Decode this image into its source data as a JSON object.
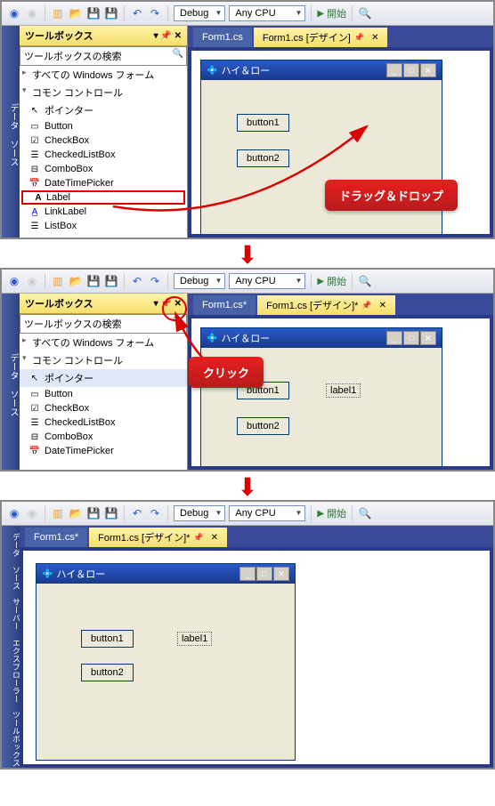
{
  "toolbar": {
    "config": "Debug",
    "platform": "Any CPU",
    "start": "開始"
  },
  "sidebar": {
    "label": "データ ソース",
    "label3": "データ ソース　サーバー エクスプローラー　ツールボックス"
  },
  "toolbox": {
    "title": "ツールボックス",
    "search": "ツールボックスの検索",
    "group1": "すべての Windows フォーム",
    "group2": "コモン コントロール",
    "items": [
      {
        "icon": "↖",
        "label": "ポインター"
      },
      {
        "icon": "▭",
        "label": "Button"
      },
      {
        "icon": "☑",
        "label": "CheckBox"
      },
      {
        "icon": "☰",
        "label": "CheckedListBox"
      },
      {
        "icon": "⊟",
        "label": "ComboBox"
      },
      {
        "icon": "📅",
        "label": "DateTimePicker"
      },
      {
        "icon": "A",
        "label": "Label"
      },
      {
        "icon": "A̲",
        "label": "LinkLabel"
      },
      {
        "icon": "☰",
        "label": "ListBox"
      }
    ]
  },
  "tabs": {
    "code": "Form1.cs",
    "design": "Form1.cs [デザイン]",
    "design_dirty": "Form1.cs [デザイン]*",
    "code_dirty": "Form1.cs*"
  },
  "form": {
    "title": "ハイ＆ロー",
    "btn1": "button1",
    "btn2": "button2",
    "label1": "label1"
  },
  "callouts": {
    "dragdrop": "ドラッグ＆ドロップ",
    "click": "クリック"
  }
}
